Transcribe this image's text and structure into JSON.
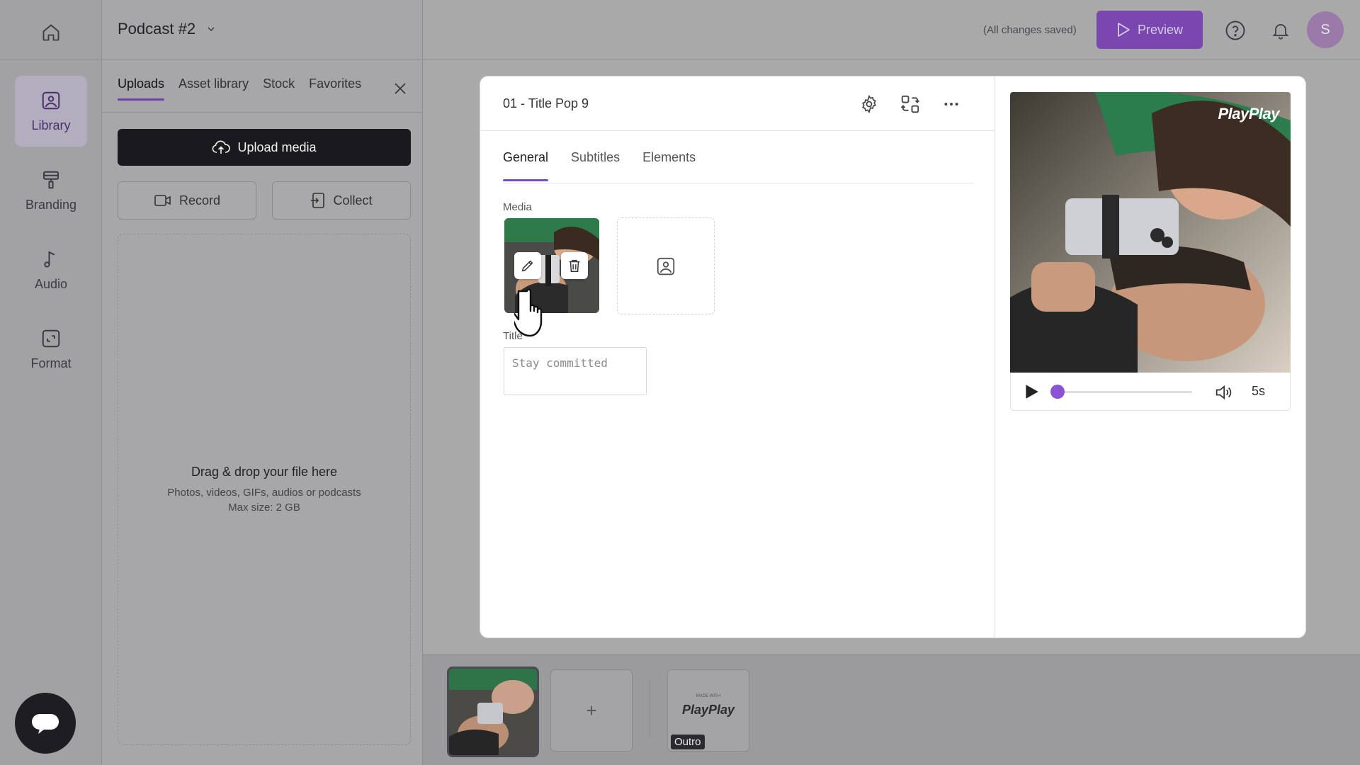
{
  "app": {
    "project_title": "Podcast #2",
    "saved_status": "(All changes saved)",
    "preview_label": "Preview",
    "avatar_initial": "S"
  },
  "rail": {
    "items": [
      {
        "label": "Library",
        "icon": "library-icon",
        "active": true
      },
      {
        "label": "Branding",
        "icon": "branding-icon",
        "active": false
      },
      {
        "label": "Audio",
        "icon": "music-note-icon",
        "active": false
      },
      {
        "label": "Format",
        "icon": "format-icon",
        "active": false
      }
    ]
  },
  "library": {
    "tabs": [
      {
        "label": "Uploads",
        "active": true
      },
      {
        "label": "Asset library",
        "active": false
      },
      {
        "label": "Stock",
        "active": false
      },
      {
        "label": "Favorites",
        "active": false
      }
    ],
    "upload_label": "Upload media",
    "record_label": "Record",
    "collect_label": "Collect",
    "dropzone": {
      "title": "Drag & drop your file here",
      "subtitle": "Photos, videos, GIFs, audios or podcasts",
      "max_size": "Max size: 2 GB"
    }
  },
  "editor": {
    "scene_title": "01 - Title Pop 9",
    "tabs": [
      {
        "label": "General",
        "active": true
      },
      {
        "label": "Subtitles",
        "active": false
      },
      {
        "label": "Elements",
        "active": false
      }
    ],
    "media_label": "Media",
    "title_label": "Title",
    "title_placeholder": "Stay committed",
    "title_value": ""
  },
  "player": {
    "brand": "PlayPlay",
    "duration": "5s",
    "progress": 0.03
  },
  "timeline": {
    "add_symbol": "+",
    "outro_brand": "PlayPlay",
    "outro_small": "MADE WITH",
    "outro_label": "Outro"
  },
  "colors": {
    "accent": "#7a4cc2",
    "preview_button": "#7a47b0",
    "overlay_gray": "#a9a9aa"
  }
}
